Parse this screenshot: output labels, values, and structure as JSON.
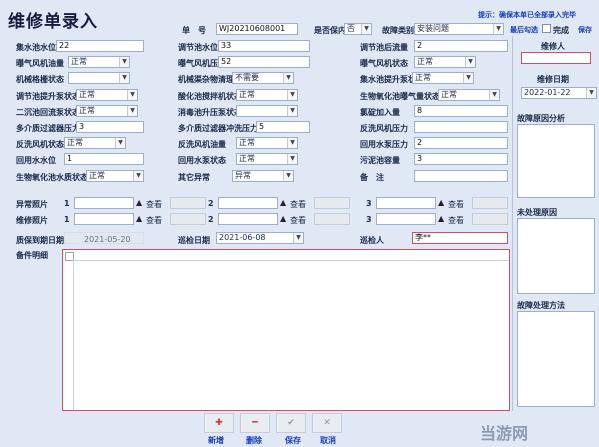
{
  "header": {
    "title": "维修单录入",
    "order_no_label": "单　号",
    "order_no": "WJ20210608001",
    "in_warranty_label": "是否保内",
    "in_warranty": "否",
    "fault_type_label": "故障类别",
    "fault_type": "安装问题",
    "tip": "提示：确保本单已全部录入完毕",
    "latest_check": "最后勾选",
    "done_label": "完成",
    "save_link": "保存"
  },
  "rows": [
    {
      "c1": {
        "label": "集水池水位",
        "value": "22"
      },
      "c2": {
        "label": "调节池水位",
        "value": "33"
      },
      "c3": {
        "label": "调节池后流量",
        "value": "2"
      }
    },
    {
      "c1": {
        "label": "曝气风机油量",
        "value": "正常"
      },
      "c2": {
        "label": "曝气风机压力",
        "value": "52"
      },
      "c3": {
        "label": "曝气风机状态",
        "value": "正常"
      }
    },
    {
      "c1": {
        "label": "机械格栅状态",
        "value": ""
      },
      "c2": {
        "label": "机械渠杂物清理",
        "value": "不需要"
      },
      "c3": {
        "label": "集水池提升泵状态",
        "value": "正常"
      }
    },
    {
      "c1": {
        "label": "调节池提升泵状态",
        "value": "正常"
      },
      "c2": {
        "label": "酸化池搅拌机状态",
        "value": "正常"
      },
      "c3": {
        "label": "生物氧化池曝气量状态",
        "value": "正常"
      }
    },
    {
      "c1": {
        "label": "二沉池回流泵状态",
        "value": "正常"
      },
      "c2": {
        "label": "消毒池升压泵状态",
        "value": ""
      },
      "c3": {
        "label": "氯碇加入量",
        "value": "8"
      }
    },
    {
      "c1": {
        "label": "多介质过滤器压力",
        "value": "3"
      },
      "c2": {
        "label": "多介质过滤器冲洗压力",
        "value": "5"
      },
      "c3": {
        "label": "反洗风机压力",
        "value": ""
      }
    },
    {
      "c1": {
        "label": "反洗风机状态",
        "value": "正常"
      },
      "c2": {
        "label": "反洗风机油量",
        "value": "正常"
      },
      "c3": {
        "label": "回用水泵压力",
        "value": "2"
      }
    },
    {
      "c1": {
        "label": "回用水水位",
        "value": "1"
      },
      "c2": {
        "label": "回用水泵状态",
        "value": "正常"
      },
      "c3": {
        "label": "污泥池容量",
        "value": "3"
      }
    },
    {
      "c1": {
        "label": "生物氧化池水质状态",
        "value": "正常"
      },
      "c2": {
        "label": "其它异常",
        "value": "异常"
      },
      "c3": {
        "label": "备　注",
        "value": ""
      }
    }
  ],
  "photos": {
    "abnormal_label": "异常照片",
    "repair_label": "维修照片",
    "nums": [
      "1",
      "2",
      "3"
    ],
    "view": "查看",
    "up_icon": "▲"
  },
  "bottom": {
    "warranty_date_label": "质保到期日期",
    "warranty_date": "2021-05-20",
    "inspect_date_label": "巡检日期",
    "inspect_date": "2021-06-08",
    "inspector_label": "巡检人",
    "inspector": "李**",
    "parts_label": "备件明细"
  },
  "side": {
    "repairer_label": "维修人",
    "repairer": "",
    "repair_date_label": "维修日期",
    "repair_date": "2022-01-22",
    "cause_label": "故障原因分析",
    "unresolved_label": "未处理原因",
    "method_label": "故障处理方法"
  },
  "toolbar": {
    "add": "新增",
    "delete": "删除",
    "save": "保存",
    "cancel": "取消"
  },
  "watermark": "当游网"
}
